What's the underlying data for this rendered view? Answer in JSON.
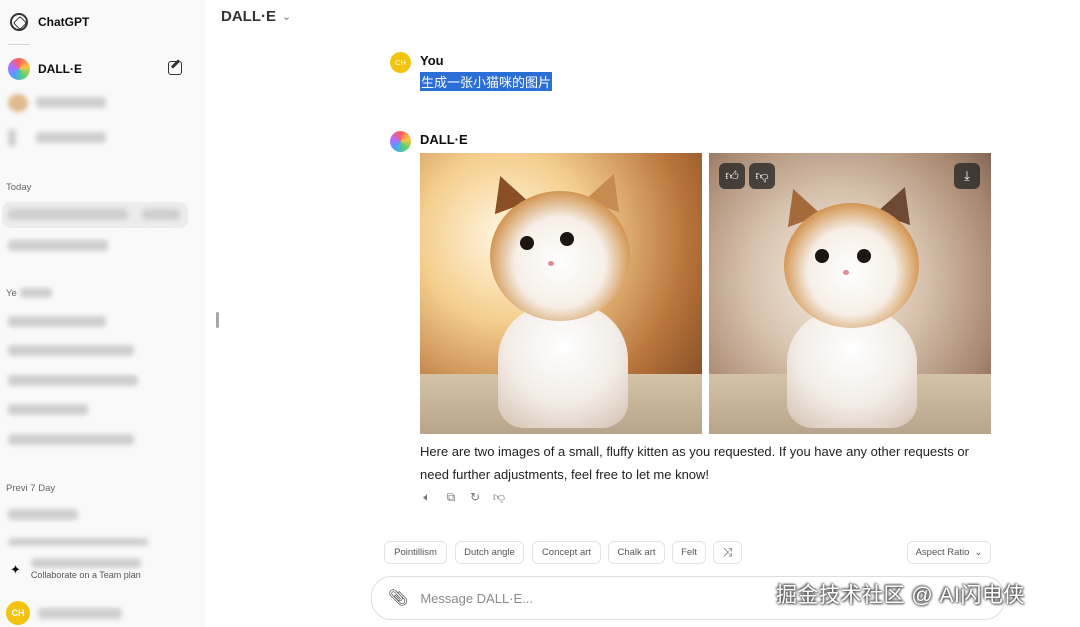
{
  "sidebar": {
    "app_title": "ChatGPT",
    "gpt_item": "DALL·E",
    "sections": {
      "today": "Today",
      "yesterday": "Ye",
      "previous": "Previ  7 Day"
    },
    "upgrade": {
      "subtitle": "Collaborate on a Team plan"
    },
    "user_initials": "CH"
  },
  "header": {
    "model_name": "DALL·E",
    "chevron": "⌄"
  },
  "conversation": {
    "user": {
      "initials": "CH",
      "name": "You",
      "message": "生成一张小猫咪的图片"
    },
    "bot": {
      "name": "DALL·E",
      "response": "Here are two images of a small, fluffy kitten as you requested. If you have any other requests or need further adjustments, feel free to let me know!"
    }
  },
  "style_chips": [
    "Pointillism",
    "Dutch angle",
    "Concept art",
    "Chalk art",
    "Felt"
  ],
  "aspect_ratio": {
    "label": "Aspect Ratio",
    "chevron": "⌄"
  },
  "composer": {
    "placeholder": "Message DALL·E..."
  },
  "watermark": "掘金技术社区 @ AI闪电侠",
  "colors": {
    "selection": "#2b6fd6",
    "user_avatar": "#f2c40f"
  },
  "icons": [
    "chatgpt-logo-icon",
    "edit-icon",
    "sparkle-icon",
    "thumbs-up-icon",
    "thumbs-down-icon",
    "download-icon",
    "speaker-icon",
    "copy-icon",
    "regenerate-icon",
    "shuffle-icon",
    "paperclip-icon"
  ]
}
